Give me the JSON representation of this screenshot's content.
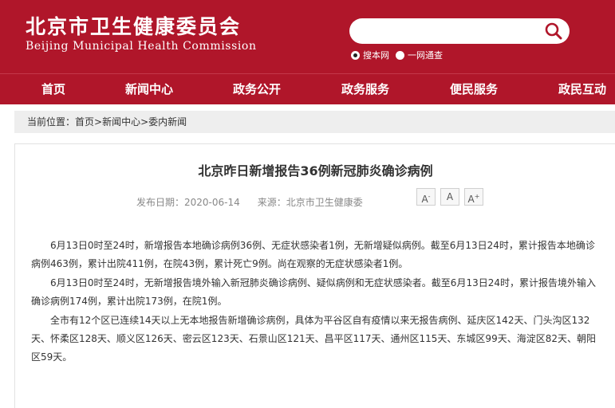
{
  "site": {
    "name_cn": "北京市卫生健康委员会",
    "name_en": "Beijing Municipal Health Commission"
  },
  "search": {
    "value": "",
    "options": [
      "搜本网",
      "一网通查"
    ],
    "selected": "搜本网"
  },
  "nav": {
    "items": [
      "首页",
      "新闻中心",
      "政务公开",
      "政务服务",
      "便民服务",
      "政民互动"
    ]
  },
  "breadcrumb": {
    "prefix": "当前位置：",
    "items": [
      "首页",
      "新闻中心",
      "委内新闻"
    ],
    "separator": ">"
  },
  "article": {
    "title": "北京昨日新增报告36例新冠肺炎确诊病例",
    "date_label": "发布日期：",
    "date": "2020-06-14",
    "source_label": "来源：",
    "source": "北京市卫生健康委",
    "font_buttons": {
      "smaller": "A",
      "smaller_mark": "-",
      "normal": "A",
      "larger": "A",
      "larger_mark": "+"
    },
    "paragraphs": [
      "6月13日0时至24时，新增报告本地确诊病例36例、无症状感染者1例，无新增疑似病例。截至6月13日24时，累计报告本地确诊病例463例，累计出院411例，在院43例，累计死亡9例。尚在观察的无症状感染者1例。",
      "6月13日0时至24时，无新增报告境外输入新冠肺炎确诊病例、疑似病例和无症状感染者。截至6月13日24时，累计报告境外输入确诊病例174例，累计出院173例，在院1例。",
      "全市有12个区已连续14天以上无本地报告新增确诊病例，具体为平谷区自有疫情以来无报告病例、延庆区142天、门头沟区132天、怀柔区128天、顺义区126天、密云区123天、石景山区121天、昌平区117天、通州区115天、东城区99天、海淀区82天、朝阳区59天。"
    ]
  },
  "colors": {
    "brand_red": "#b0162a",
    "crumb_bg": "#eeeeee"
  }
}
